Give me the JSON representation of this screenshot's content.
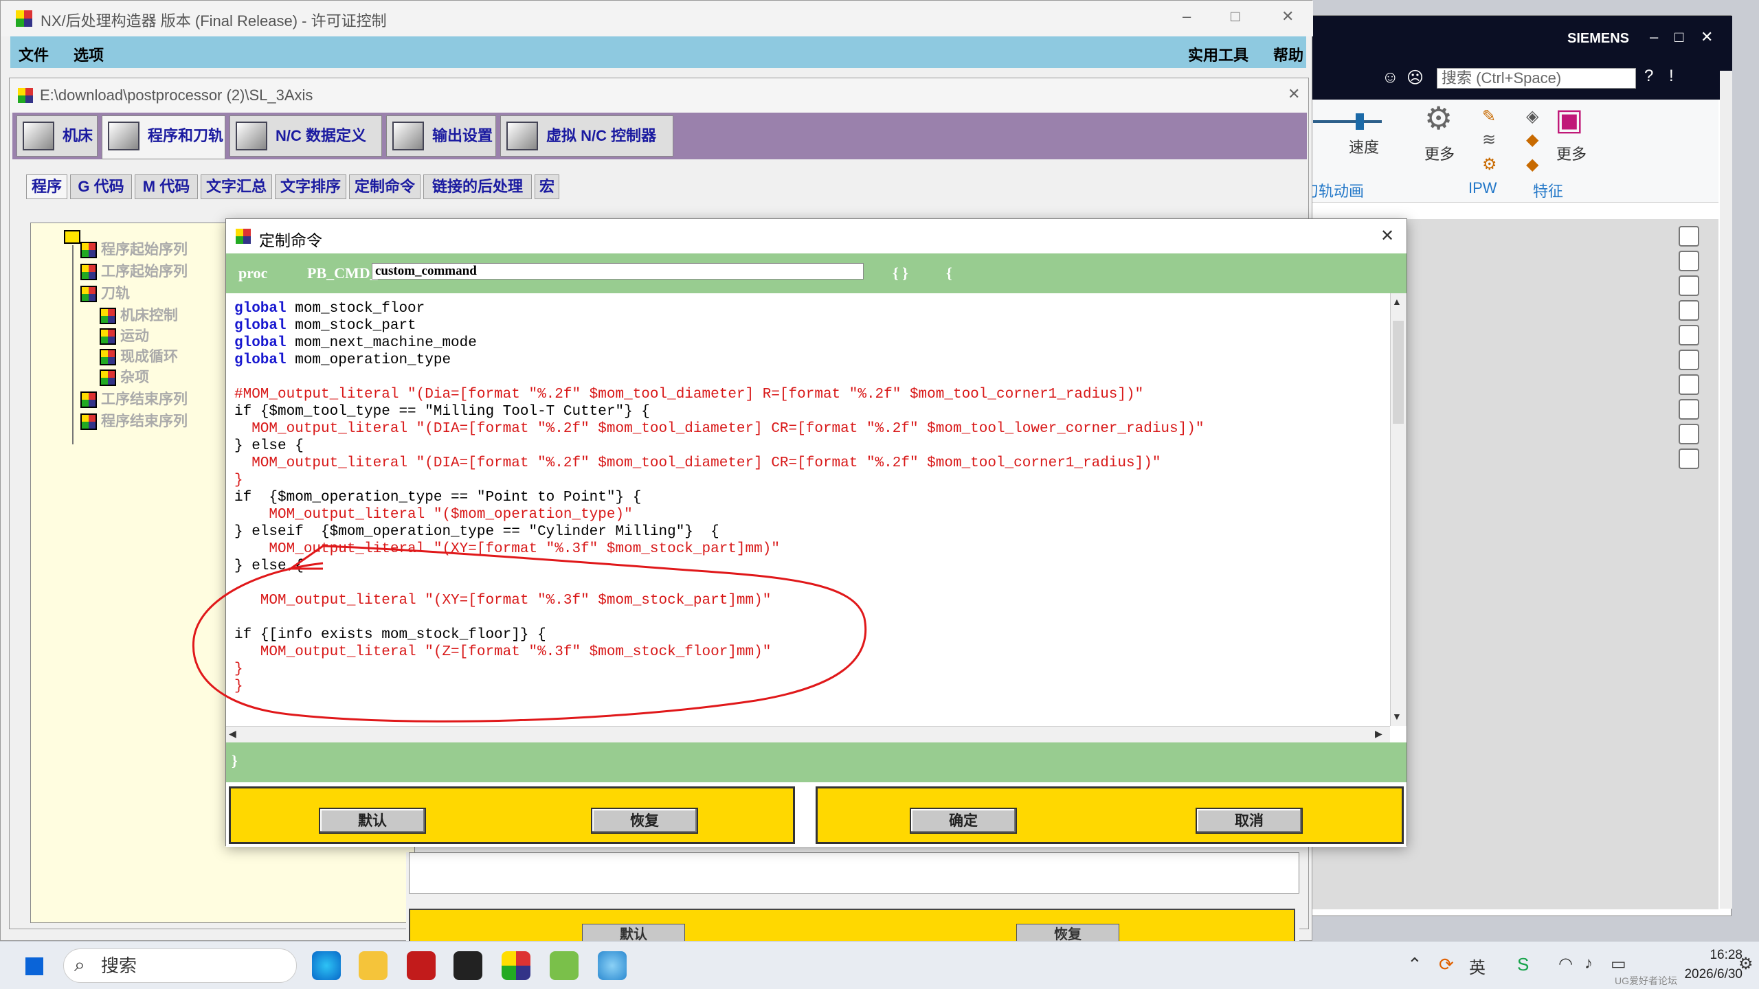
{
  "nx": {
    "brand": "SIEMENS",
    "search_placeholder": "搜索 (Ctrl+Space)",
    "speed_label": "速度",
    "more1_label": "更多",
    "more2_label": "更多",
    "grp_animation": "刀轨动画",
    "grp_ipw": "IPW",
    "grp_feature": "特征"
  },
  "pb": {
    "title": "NX/后处理构造器 版本 (Final Release) - 许可证控制",
    "menu_file": "文件",
    "menu_options": "选项",
    "menu_utils": "实用工具",
    "menu_help": "帮助"
  },
  "sub": {
    "title": "E:\\download\\postprocessor (2)\\SL_3Axis",
    "tabs": [
      {
        "label": "机床"
      },
      {
        "label": "程序和刀轨"
      },
      {
        "label": "N/C 数据定义"
      },
      {
        "label": "输出设置"
      },
      {
        "label": "虚拟 N/C 控制器"
      }
    ],
    "subtabs": [
      {
        "label": "程序"
      },
      {
        "label": "G 代码"
      },
      {
        "label": "M 代码"
      },
      {
        "label": "文字汇总"
      },
      {
        "label": "文字排序"
      },
      {
        "label": "定制命令"
      },
      {
        "label": "链接的后处理"
      },
      {
        "label": "宏"
      }
    ],
    "tree": [
      {
        "label": "程序起始序列"
      },
      {
        "label": "工序起始序列"
      },
      {
        "label": "刀轨"
      },
      {
        "label": "机床控制"
      },
      {
        "label": "运动"
      },
      {
        "label": "现成循环"
      },
      {
        "label": "杂项"
      },
      {
        "label": "工序结束序列"
      },
      {
        "label": "程序结束序列"
      }
    ],
    "behind_default": "默认",
    "behind_restore": "恢复"
  },
  "dialog": {
    "title": "定制命令",
    "proc_label": "proc",
    "proc_prefix": "PB_CMD_",
    "proc_name": "custom_command",
    "proc_braces": "{ }",
    "proc_open": "{",
    "close_brace": "}",
    "btn_default": "默认",
    "btn_restore": "恢复",
    "btn_ok": "确定",
    "btn_cancel": "取消",
    "code": [
      "global mom_stock_floor",
      "global mom_stock_part",
      "global mom_next_machine_mode",
      "global mom_operation_type",
      "",
      "#MOM_output_literal \"(Dia=[format \"%.2f\" $mom_tool_diameter] R=[format \"%.2f\" $mom_tool_corner1_radius])\"",
      "if {$mom_tool_type == \"Milling Tool-T Cutter\"} {",
      "  MOM_output_literal \"(DIA=[format \"%.2f\" $mom_tool_diameter] CR=[format \"%.2f\" $mom_tool_lower_corner_radius])\"",
      "} else {",
      "  MOM_output_literal \"(DIA=[format \"%.2f\" $mom_tool_diameter] CR=[format \"%.2f\" $mom_tool_corner1_radius])\"",
      "}",
      "if  {$mom_operation_type == \"Point to Point\"} {",
      "    MOM_output_literal \"($mom_operation_type)\"",
      "} elseif  {$mom_operation_type == \"Cylinder Milling\"}  {",
      "    MOM_output_literal \"(XY=[format \"%.3f\" $mom_stock_part]mm)\"",
      "} else {",
      "",
      "   MOM_output_literal \"(XY=[format \"%.3f\" $mom_stock_part]mm)\"",
      "",
      "if {[info exists mom_stock_floor]} {",
      "   MOM_output_literal \"(Z=[format \"%.3f\" $mom_stock_floor]mm)\"",
      "}",
      "}"
    ]
  },
  "taskbar": {
    "search": "搜索",
    "time": "16:28",
    "date": "2026/6/30",
    "watermark": "UG爱好者论坛 WWW.UGSNX.COM"
  },
  "colors": {
    "keyword": "#1818d0",
    "string": "#d81818",
    "literal": "#1a9a9a",
    "dialog_bar": "#98cc90",
    "button_panel": "#ffd800",
    "tab_strip": "#9a81ac",
    "annotation": "#e0181a"
  }
}
